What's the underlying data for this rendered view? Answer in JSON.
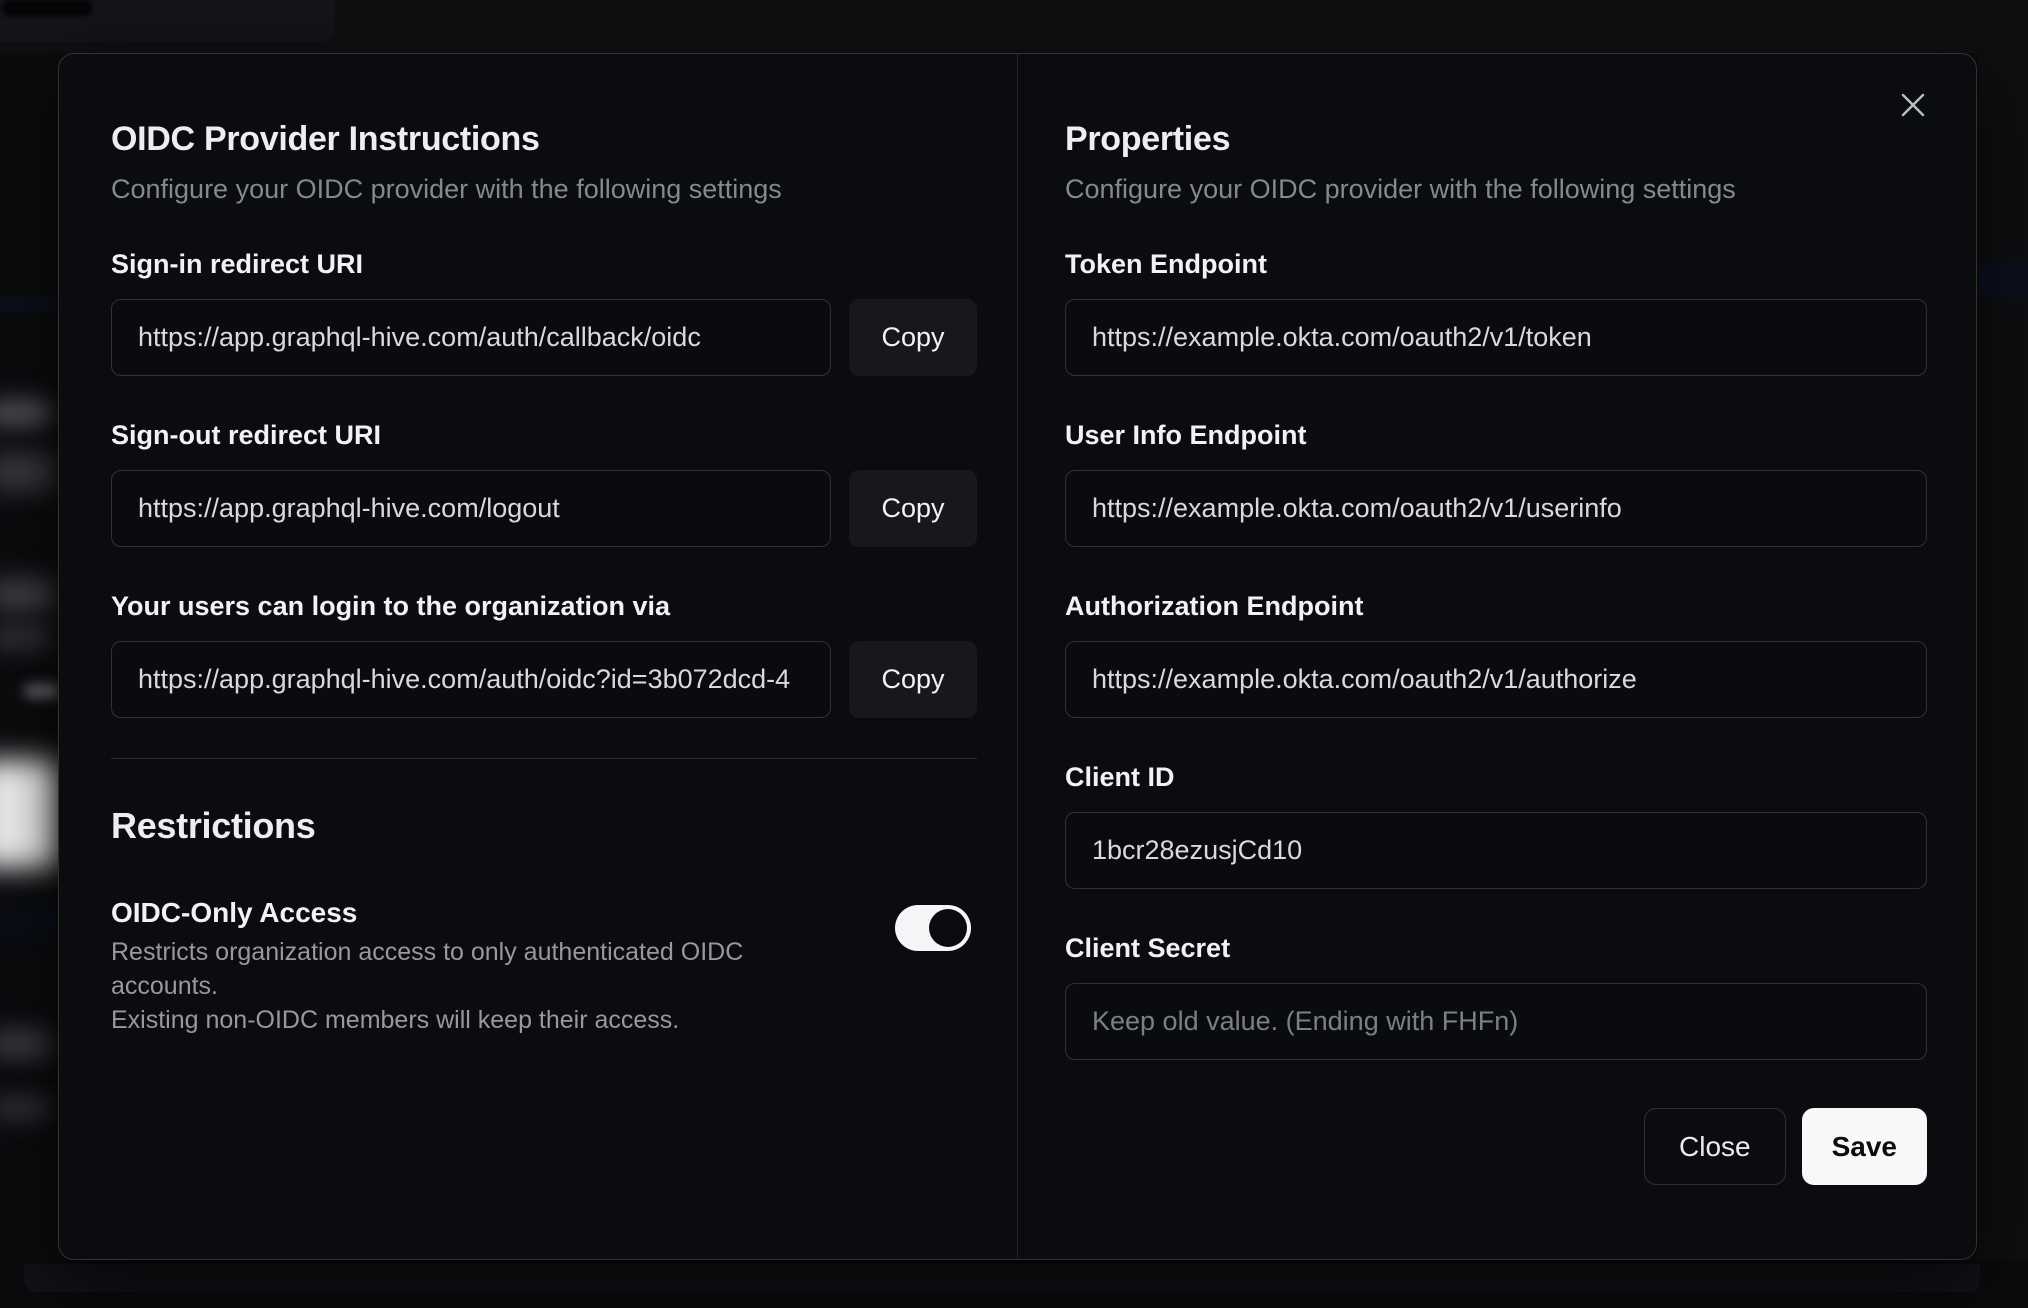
{
  "dialog": {
    "close_icon": "x-close",
    "left": {
      "title": "OIDC Provider Instructions",
      "subtitle": "Configure your OIDC provider with the following settings",
      "fields": [
        {
          "label": "Sign-in redirect URI",
          "value": "https://app.graphql-hive.com/auth/callback/oidc",
          "button": "Copy"
        },
        {
          "label": "Sign-out redirect URI",
          "value": "https://app.graphql-hive.com/logout",
          "button": "Copy"
        },
        {
          "label": "Your users can login to the organization via",
          "value": "https://app.graphql-hive.com/auth/oidc?id=3b072dcd-4",
          "button": "Copy"
        }
      ],
      "restrictions": {
        "title": "Restrictions",
        "toggle_label": "OIDC-Only Access",
        "description_line1": "Restricts organization access to only authenticated OIDC accounts.",
        "description_line2": "Existing non-OIDC members will keep their access.",
        "toggle_state": "on"
      }
    },
    "right": {
      "title": "Properties",
      "subtitle": "Configure your OIDC provider with the following settings",
      "fields": [
        {
          "label": "Token Endpoint",
          "value": "https://example.okta.com/oauth2/v1/token"
        },
        {
          "label": "User Info Endpoint",
          "value": "https://example.okta.com/oauth2/v1/userinfo"
        },
        {
          "label": "Authorization Endpoint",
          "value": "https://example.okta.com/oauth2/v1/authorize"
        },
        {
          "label": "Client ID",
          "value": "1bcr28ezusjCd10"
        },
        {
          "label": "Client Secret",
          "value": "",
          "placeholder": "Keep old value. (Ending with FHFn)"
        }
      ],
      "buttons": {
        "close": "Close",
        "save": "Save"
      }
    }
  },
  "colors": {
    "modal_bg": "#0b0c0f",
    "input_border": "#303236",
    "copy_button_bg": "#17181c",
    "save_button_bg": "#f7f8f8",
    "toggle_on_track": "#f5f6f7",
    "muted_text": "#85888c"
  }
}
